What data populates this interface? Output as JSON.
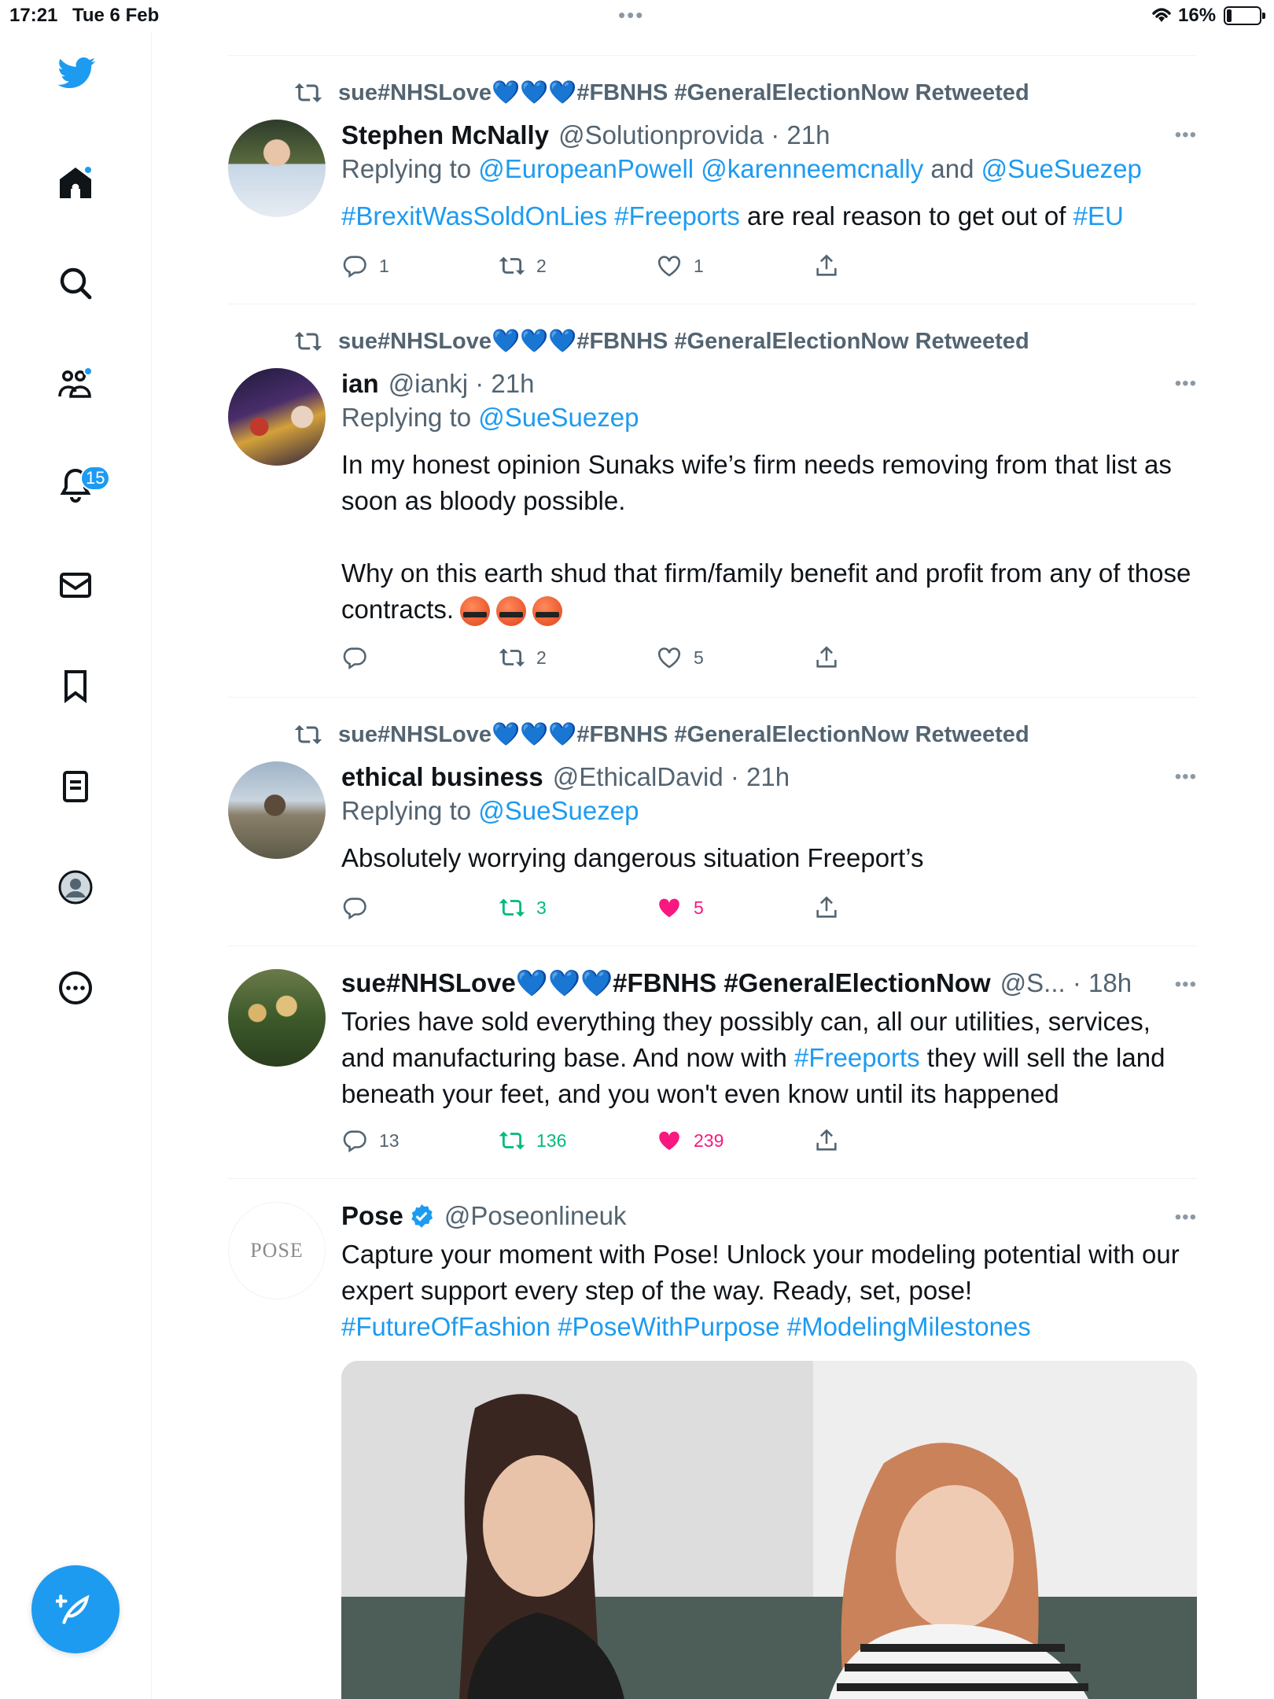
{
  "status_bar": {
    "time": "17:21",
    "date": "Tue 6 Feb",
    "battery": "16%",
    "battery_level": 0.16,
    "dots": "•••"
  },
  "sidebar": {
    "logo": "twitter-bird-icon",
    "items": [
      {
        "icon": "home-icon",
        "dot": true
      },
      {
        "icon": "search-icon"
      },
      {
        "icon": "communities-icon",
        "dot": true
      },
      {
        "icon": "bell-icon",
        "badge": "15"
      },
      {
        "icon": "mail-icon"
      },
      {
        "icon": "bookmark-icon"
      },
      {
        "icon": "list-icon"
      },
      {
        "icon": "profile-icon"
      },
      {
        "icon": "more-circle-icon"
      }
    ],
    "compose_icon": "compose-feather-icon"
  },
  "colors": {
    "accent": "#1d9bf0",
    "muted": "#536471",
    "retweet_active": "#00ba7c",
    "like_active": "#f91880"
  },
  "tweets": [
    {
      "retweeted_by": "sue#NHSLove💙💙💙#FBNHS #GeneralElectionNow Retweeted",
      "name": "Stephen McNally",
      "handle": "@Solutionprovida · 21h",
      "replying_label": "Replying to",
      "replying_to": "@EuropeanPowell @karenneemcnally",
      "replying_and": "and",
      "replying_to_2": "@SueSuezep",
      "body_a": "#BrexitWasSoldOnLies #Freeports",
      "body_b": " are real reason to get out of ",
      "body_c": "#EU",
      "replies": "1",
      "retweets": "2",
      "likes": "1"
    },
    {
      "retweeted_by": "sue#NHSLove💙💙💙#FBNHS #GeneralElectionNow Retweeted",
      "name": "ian",
      "handle": "@iankj · 21h",
      "replying_label": "Replying to",
      "replying_to": "@SueSuezep",
      "body_p1": "In my honest opinion Sunaks wife’s firm needs removing from that list as soon as bloody possible.",
      "body_p2": "Why on this earth shud that firm/family benefit and profit from any of those contracts.",
      "replies": "",
      "retweets": "2",
      "likes": "5"
    },
    {
      "retweeted_by": "sue#NHSLove💙💙💙#FBNHS #GeneralElectionNow Retweeted",
      "name": "ethical business",
      "handle": "@EthicalDavid · 21h",
      "replying_label": "Replying to",
      "replying_to": "@SueSuezep",
      "body": "Absolutely worrying dangerous situation Freeport’s",
      "replies": "",
      "retweets": "3",
      "likes": "5"
    },
    {
      "name": "sue#NHSLove💙💙💙#FBNHS #GeneralElectionNow",
      "handle": "@S... · 18h",
      "body_a": "Tories have sold everything they possibly can, all our utilities,  services, and manufacturing base. And now with ",
      "body_b": "#Freeports",
      "body_c": " they will sell the land beneath your feet, and you won't even know until its happened",
      "replies": "13",
      "retweets": "136",
      "likes": "239"
    },
    {
      "name": "Pose",
      "handle": "@Poseonlineuk",
      "avatar_text": "POSE",
      "body": "Capture your moment with Pose! Unlock your modeling potential with our expert support every step of the way. Ready, set, pose!",
      "hashtags": "#FutureOfFashion #PoseWithPurpose #ModelingMilestones"
    }
  ]
}
